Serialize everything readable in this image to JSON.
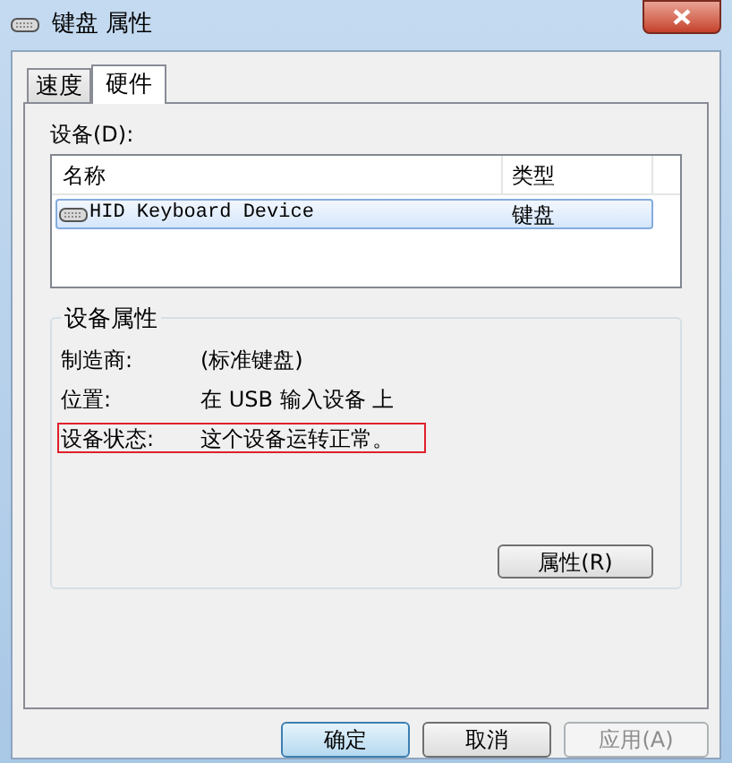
{
  "window": {
    "title": "键盘 属性"
  },
  "tabs": [
    {
      "label": "速度",
      "selected": false
    },
    {
      "label": "硬件",
      "selected": true
    }
  ],
  "devices": {
    "label": "设备(D):",
    "columns": [
      "名称",
      "类型"
    ],
    "rows": [
      {
        "name": "HID Keyboard Device",
        "type": "键盘",
        "selected": true
      }
    ]
  },
  "device_properties": {
    "title": "设备属性",
    "fields": [
      {
        "label": "制造商:",
        "value": "(标准键盘)",
        "highlighted": false
      },
      {
        "label": "位置:",
        "value": "在 USB 输入设备 上",
        "highlighted": false
      },
      {
        "label": "设备状态:",
        "value": "这个设备运转正常。",
        "highlighted": true
      }
    ],
    "properties_button": "属性(R)"
  },
  "buttons": [
    {
      "label": "确定",
      "default": true,
      "disabled": false
    },
    {
      "label": "取消",
      "default": false,
      "disabled": false
    },
    {
      "label": "应用(A)",
      "default": false,
      "disabled": true
    }
  ]
}
